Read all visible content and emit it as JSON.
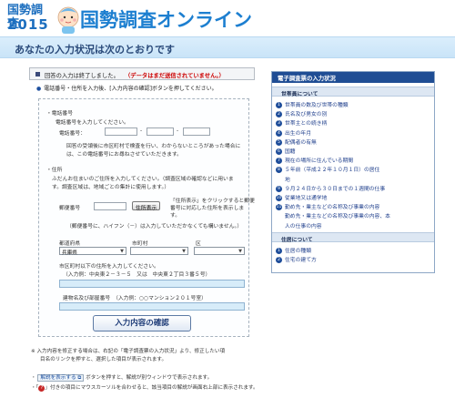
{
  "header": {
    "logo_line1": "国勢調査",
    "logo_line2": "2015",
    "site_title": "国勢調査オンライン"
  },
  "banner": {
    "text": "あなたの入力状況は次のとおりです"
  },
  "notice": {
    "done": "回答の入力は終了しました。",
    "warn": "（データはまだ送信されていません。）"
  },
  "instruction": "電話番号・住所を入力後、[入力内容の確認]ボタンを押してください。",
  "form": {
    "phone": {
      "label": "・電話番号",
      "prompt": "電話番号を入力してください。",
      "field_label": "電話番号：",
      "note1": "回答の受領後に市区町村で検査を行い、わからないところがあった場合に",
      "note2": "は、この電話番号にお尋ねさせていただきます。"
    },
    "address": {
      "label": "・住所",
      "prompt1": "ふだんお住まいのご住所を入力してください。（調査区域の確認などに用いま",
      "prompt2": "す。調査区域は、地域ごとの集計に使用します。）",
      "postal_label": "郵便番号",
      "lookup_button": "住所表示",
      "lookup_note1": "「住所表示」をクリックすると郵便",
      "lookup_note2": "番号に対応した住所を表示しま",
      "lookup_note3": "す。",
      "postal_hint": "（郵便番号に、ハイフン（－）は入力していただかなくても構いません。）",
      "pref_label": "都道府県",
      "city_label": "市町村",
      "ward_label": "区",
      "pref_value": "兵庫県",
      "below_prompt": "市区町村以下の住所を入力してください。",
      "example": "（入力例：中央東２－３－５　又は　中央東２丁目３番５号）",
      "building_label": "建物名及び部屋番号　（入力例：○○マンション２０１号室）"
    }
  },
  "confirm_button": "入力内容の確認",
  "footer": {
    "note1": "※ 入力内容を修正する場合は、右記の「電子調査票の入力状況」より、修正したい項",
    "note2": "目名のリンクを押すと、選択した項目が表示されます。",
    "help_button": "解説を表示する",
    "help_text": "ボタンを押すと、解説が別ウィンドウで表示されます。",
    "red_text": "付きの項目にマウスカーソルを合わせると、該当項目の解説が画面右上部に表示されます。"
  },
  "sidebar": {
    "title": "電子調査票の入力状況",
    "section1": "世帯員について",
    "items1": [
      {
        "n": "1",
        "label": "世帯員の数及び世帯の種類"
      },
      {
        "n": "2",
        "label": "氏名及び男女の別"
      },
      {
        "n": "3",
        "label": "世帯主との続き柄"
      },
      {
        "n": "4",
        "label": "出生の年月"
      },
      {
        "n": "5",
        "label": "配偶者の有無"
      },
      {
        "n": "6",
        "label": "国籍"
      },
      {
        "n": "7",
        "label": "現在の場所に住んでいる期間"
      },
      {
        "n": "8",
        "label": "５年前（平成２２年１０月１日）の居住"
      },
      {
        "n": "",
        "label": "地"
      },
      {
        "n": "9",
        "label": "９月２４日から３０日までの１週間の仕事"
      },
      {
        "n": "10",
        "label": "従業地又は通学地"
      },
      {
        "n": "11",
        "label": "勤め先・業主などの名称及び事業の内容"
      },
      {
        "n": "",
        "label": "勤め先・業主などの名称及び事業の内容、本"
      },
      {
        "n": "",
        "label": "人の仕事の内容"
      }
    ],
    "section2": "住居について",
    "items2": [
      {
        "n": "1",
        "label": "住居の種類"
      },
      {
        "n": "2",
        "label": "住宅の建て方"
      }
    ]
  }
}
